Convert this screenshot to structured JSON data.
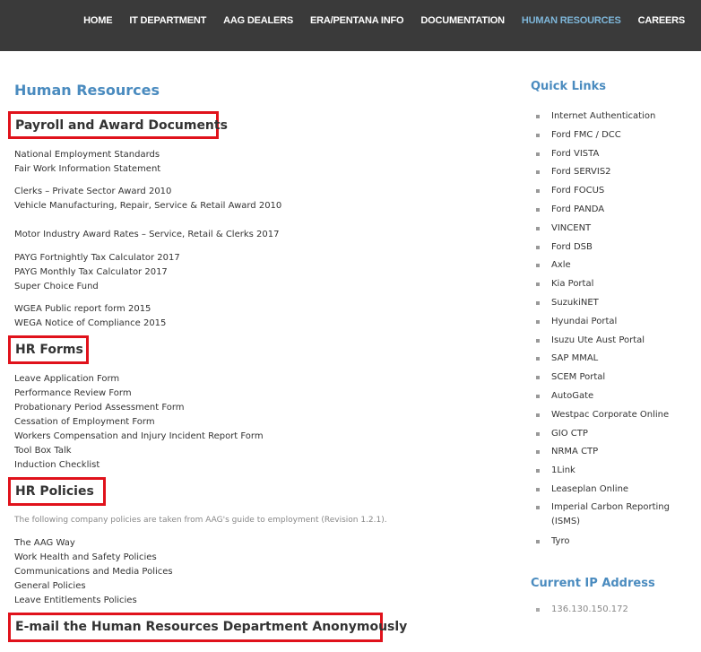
{
  "nav": {
    "items": [
      {
        "label": "HOME"
      },
      {
        "label": "IT DEPARTMENT"
      },
      {
        "label": "AAG DEALERS"
      },
      {
        "label": "ERA/PENTANA INFO"
      },
      {
        "label": "DOCUMENTATION"
      },
      {
        "label": "HUMAN RESOURCES",
        "active": true
      },
      {
        "label": "CAREERS"
      }
    ],
    "active_color": "#7eb6d9"
  },
  "page": {
    "title": "Human Resources"
  },
  "payroll": {
    "heading": "Payroll and Award Documents",
    "links": [
      "National Employment Standards",
      "Fair Work Information Statement",
      "Clerks – Private Sector Award 2010",
      "Vehicle Manufacturing, Repair, Service & Retail Award 2010",
      "Motor Industry Award Rates – Service, Retail & Clerks 2017",
      "PAYG Fortnightly Tax Calculator 2017",
      "PAYG Monthly Tax Calculator 2017",
      "Super Choice Fund",
      "WGEA Public report form 2015",
      "WEGA Notice of Compliance 2015"
    ]
  },
  "hr_forms": {
    "heading": "HR Forms",
    "links": [
      "Leave Application Form",
      "Performance Review Form",
      "Probationary Period Assessment Form",
      "Cessation of Employment Form",
      "Workers Compensation and Injury Incident Report Form",
      "Tool Box Talk",
      "Induction Checklist"
    ]
  },
  "hr_policies": {
    "heading": "HR Policies",
    "intro": "The following company policies are taken from AAG's guide to employment (Revision 1.2.1).",
    "links": [
      "The AAG Way",
      "Work Health and Safety Policies",
      "Communications and Media Polices",
      "General Policies",
      "Leave Entitlements Policies"
    ]
  },
  "email": {
    "heading": "E-mail the Human Resources Department Anonymously"
  },
  "sidebar": {
    "quick_links_title": "Quick Links",
    "quick_links": [
      "Internet Authentication",
      "Ford FMC / DCC",
      "Ford VISTA",
      "Ford SERVIS2",
      "Ford FOCUS",
      "Ford PANDA",
      "VINCENT",
      "Ford DSB",
      "Axle",
      "Kia Portal",
      "SuzukiNET",
      "Hyundai Portal",
      "Isuzu Ute Aust Portal",
      "SAP MMAL",
      "SCEM Portal",
      "AutoGate",
      "Westpac Corporate Online",
      "GIO CTP",
      "NRMA CTP",
      "1Link",
      "Leaseplan Online",
      "Imperial Carbon Reporting (ISMS)",
      "Tyro"
    ],
    "ip_title": "Current IP Address",
    "ip_value": "136.130.150.172"
  },
  "colors": {
    "header_bg": "#3a3a3a",
    "title_blue": "#4a8bbf",
    "highlight_red": "#e0121b"
  }
}
